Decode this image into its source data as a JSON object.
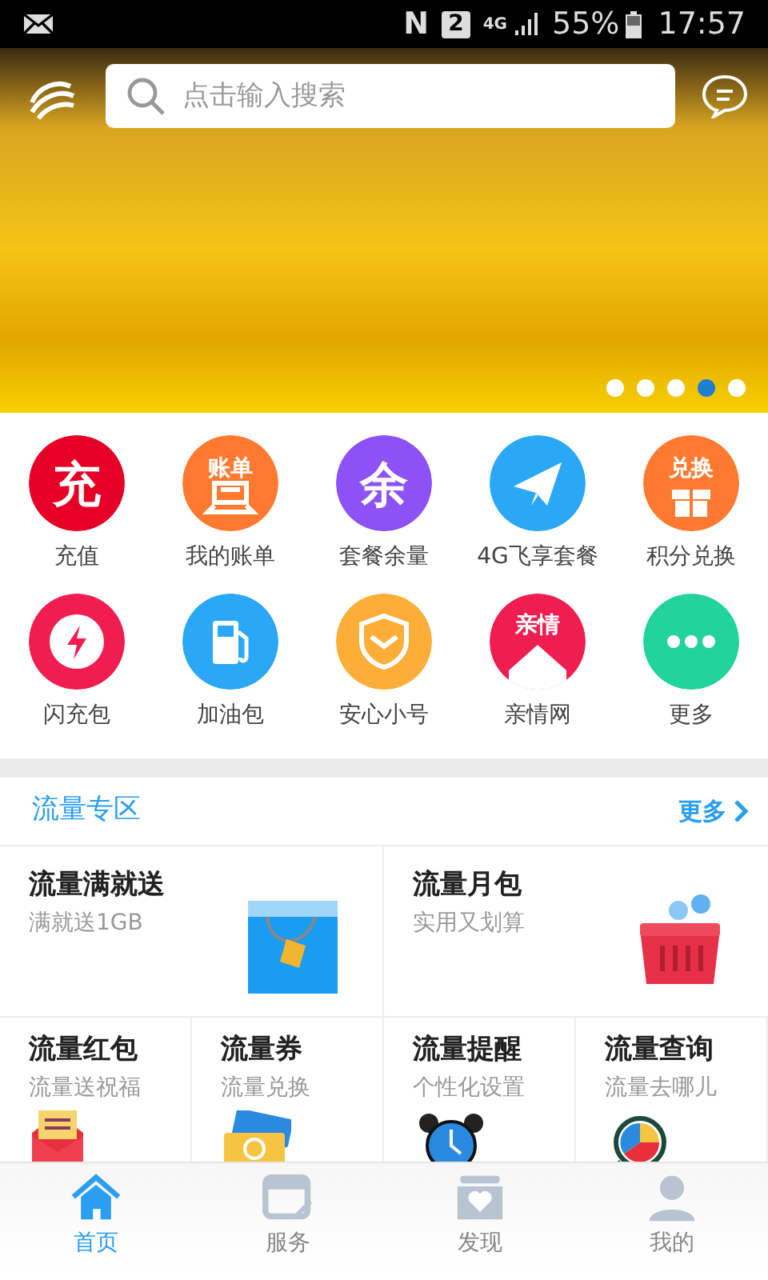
{
  "status_bar": {
    "nfc": "N",
    "sim": "2",
    "network": "4G",
    "battery": "55%",
    "time": "17:57"
  },
  "search": {
    "placeholder": "点击输入搜索"
  },
  "banner": {
    "dots": [
      {
        "selected": false
      },
      {
        "selected": false
      },
      {
        "selected": false
      },
      {
        "selected": true
      },
      {
        "selected": false
      }
    ]
  },
  "shortcuts": [
    {
      "label": "充值",
      "kind": "glyph",
      "icon_text": "充",
      "color": "#e60026"
    },
    {
      "label": "我的账单",
      "kind": "bill",
      "icon_text": "账单",
      "color": "#ff7a30"
    },
    {
      "label": "套餐余量",
      "kind": "glyph",
      "icon_text": "余",
      "color": "#8c52f5"
    },
    {
      "label": "4G飞享套餐",
      "kind": "plane",
      "color": "#2aa8f5"
    },
    {
      "label": "积分兑换",
      "kind": "gift",
      "icon_text": "兑换",
      "color": "#ff7a30"
    },
    {
      "label": "闪充包",
      "kind": "bolt",
      "color": "#f01e50"
    },
    {
      "label": "加油包",
      "kind": "fuel",
      "color": "#2aa8f5"
    },
    {
      "label": "安心小号",
      "kind": "shield",
      "color": "#fcae38"
    },
    {
      "label": "亲情网",
      "kind": "house",
      "icon_text": "亲情",
      "color": "#f01e50"
    },
    {
      "label": "更多",
      "kind": "dots",
      "color": "#22d39a"
    }
  ],
  "section": {
    "title": "流量专区",
    "more": "更多"
  },
  "tiles_large": [
    {
      "title": "流量满就送",
      "subtitle": "满就送1GB",
      "kind": "bag"
    },
    {
      "title": "流量月包",
      "subtitle": "实用又划算",
      "kind": "basket"
    }
  ],
  "tiles_small": [
    {
      "title": "流量红包",
      "subtitle": "流量送祝福",
      "kind": "envelope"
    },
    {
      "title": "流量券",
      "subtitle": "流量兑换",
      "kind": "banknote"
    },
    {
      "title": "流量提醒",
      "subtitle": "个性化设置",
      "kind": "clock"
    },
    {
      "title": "流量查询",
      "subtitle": "流量去哪儿",
      "kind": "pie"
    }
  ],
  "tab_bar": [
    {
      "label": "首页",
      "kind": "home",
      "selected": true
    },
    {
      "label": "服务",
      "kind": "service",
      "selected": false
    },
    {
      "label": "发现",
      "kind": "discover",
      "selected": false
    },
    {
      "label": "我的",
      "kind": "person",
      "selected": false
    }
  ]
}
